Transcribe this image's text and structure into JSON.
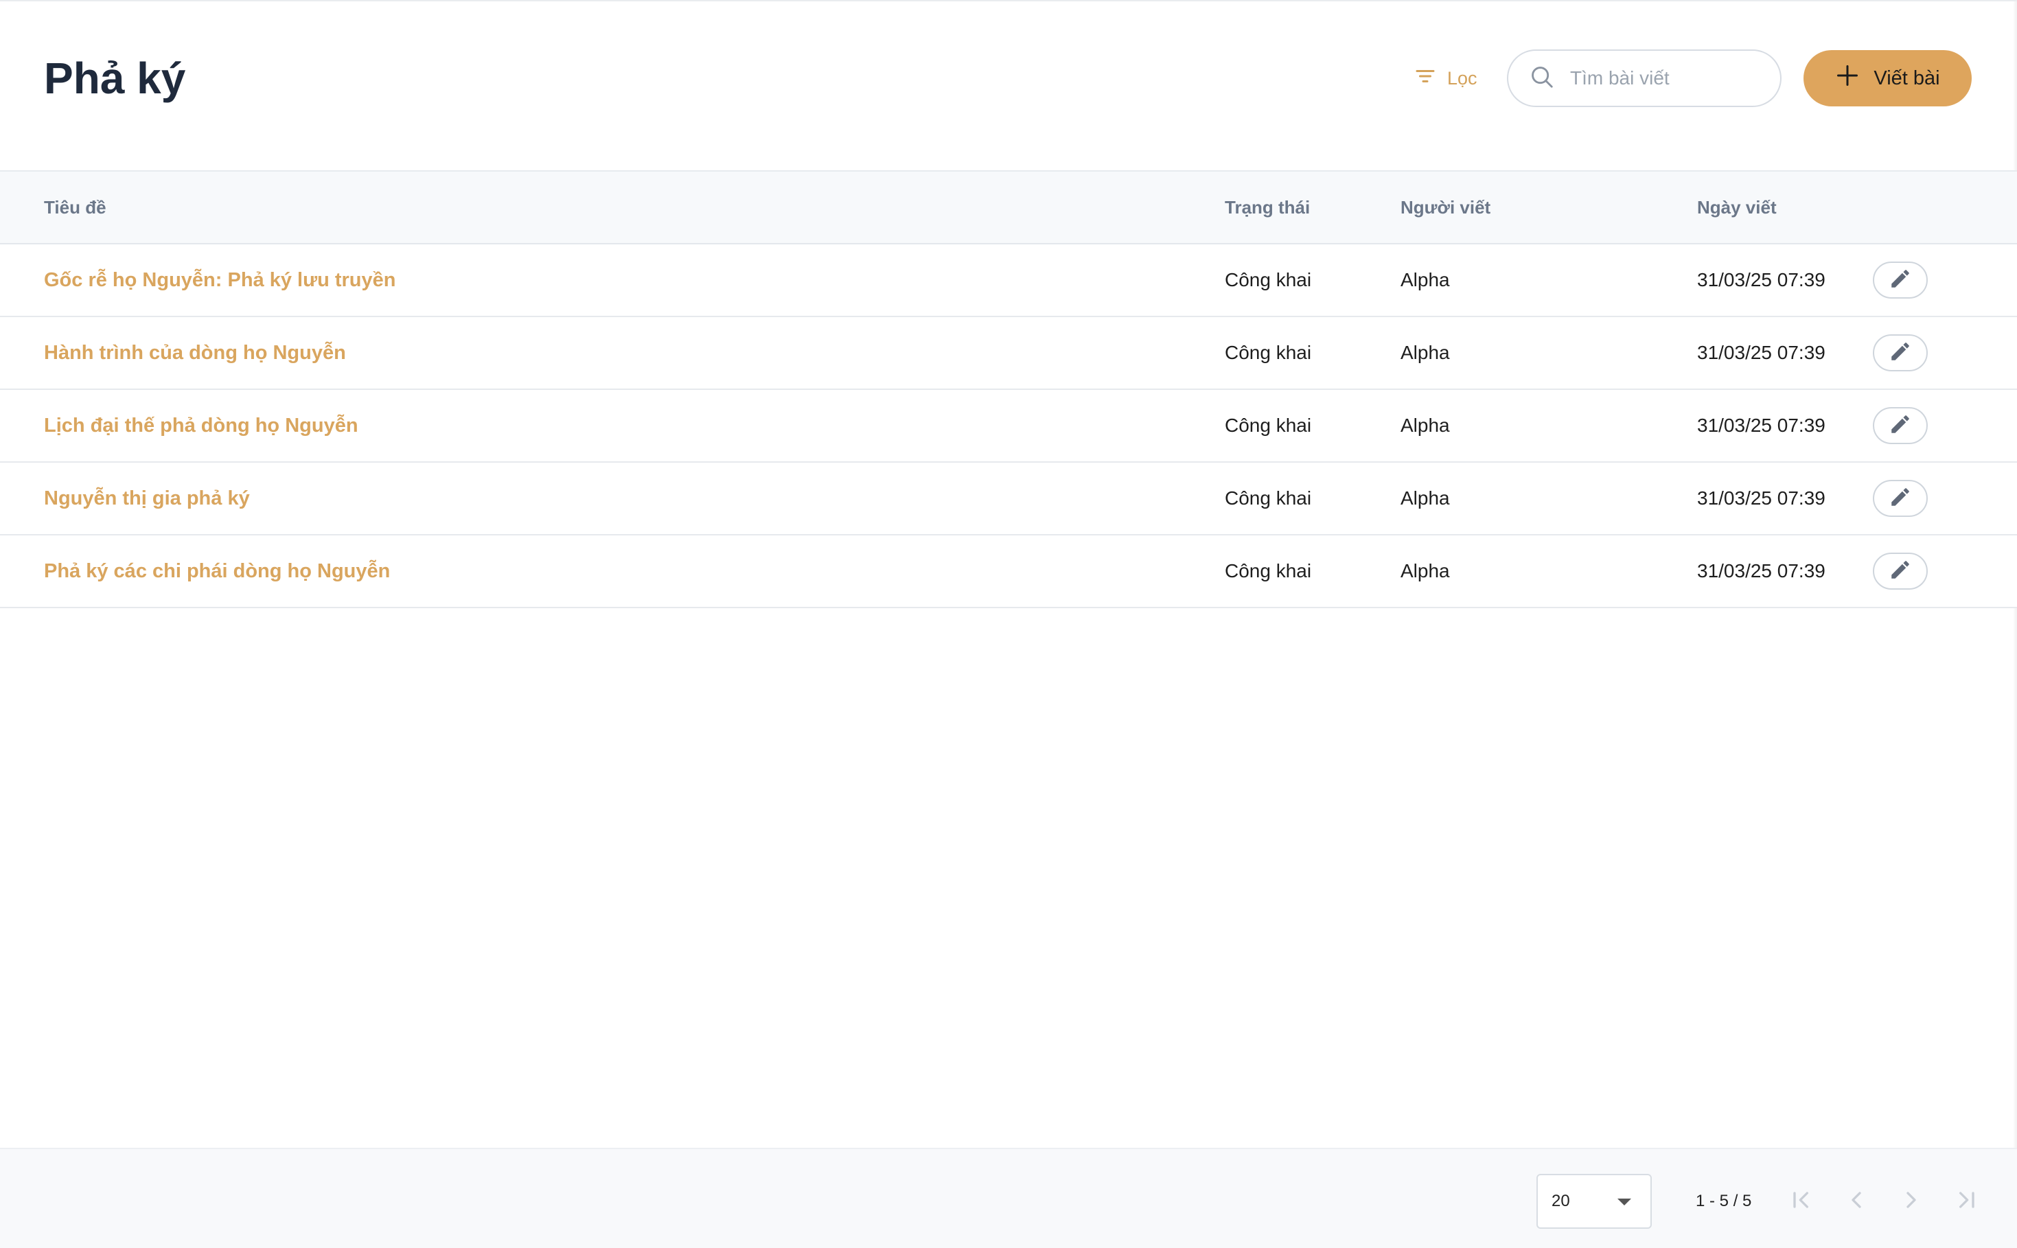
{
  "header": {
    "title": "Phả ký",
    "filter_label": "Lọc",
    "search_placeholder": "Tìm bài viết",
    "write_label": "Viết bài"
  },
  "table": {
    "columns": [
      "Tiêu đề",
      "Trạng thái",
      "Người viết",
      "Ngày viết"
    ],
    "rows": [
      {
        "title": "Gốc rễ họ Nguyễn: Phả ký lưu truyền",
        "status": "Công khai",
        "author": "Alpha",
        "date": "31/03/25 07:39"
      },
      {
        "title": "Hành trình của dòng họ Nguyễn",
        "status": "Công khai",
        "author": "Alpha",
        "date": "31/03/25 07:39"
      },
      {
        "title": "Lịch đại thế phả dòng họ Nguyễn",
        "status": "Công khai",
        "author": "Alpha",
        "date": "31/03/25 07:39"
      },
      {
        "title": "Nguyễn thị gia phả ký",
        "status": "Công khai",
        "author": "Alpha",
        "date": "31/03/25 07:39"
      },
      {
        "title": "Phả ký các chi phái dòng họ Nguyễn",
        "status": "Công khai",
        "author": "Alpha",
        "date": "31/03/25 07:39"
      }
    ]
  },
  "pagination": {
    "page_size": "20",
    "range": "1 - 5 / 5"
  },
  "icons": {
    "filter": "filter-icon",
    "search": "search-icon",
    "plus": "plus-icon",
    "edit": "pencil-icon",
    "first": "first-page-icon",
    "prev": "chevron-left-icon",
    "next": "chevron-right-icon",
    "last": "last-page-icon"
  },
  "colors": {
    "accent": "#dea55d",
    "link": "#d9a55e",
    "title": "#1f2a3c",
    "muted": "#6b7789"
  }
}
